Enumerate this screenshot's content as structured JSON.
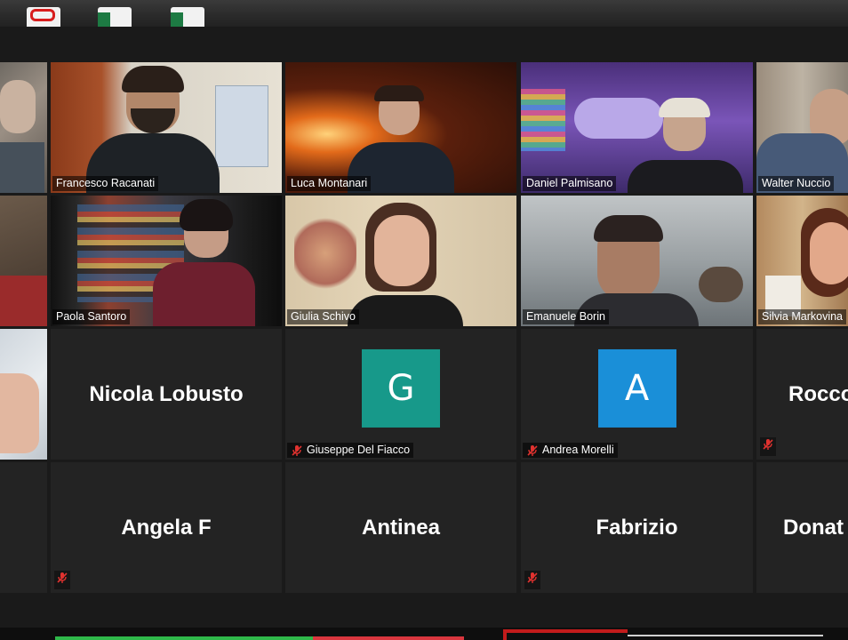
{
  "desktop": {
    "icons": [
      "pdf-file-icon",
      "excel-file-icon",
      "excel-file-icon"
    ]
  },
  "gallery": {
    "row1": [
      {
        "name": ""
      },
      {
        "name": "Francesco Racanati"
      },
      {
        "name": "Luca Montanari"
      },
      {
        "name": "Daniel Palmisano"
      },
      {
        "name": "Walter Nuccio"
      }
    ],
    "row2": [
      {
        "name": ""
      },
      {
        "name": "Paola Santoro"
      },
      {
        "name": "Giulia Schivo"
      },
      {
        "name": "Emanuele Borin"
      },
      {
        "name": "Silvia Markovina"
      }
    ],
    "row3": [
      {
        "name": ""
      },
      {
        "display_name": "Nicola Lobusto"
      },
      {
        "name": "Giuseppe Del Fiacco",
        "avatar_letter": "G",
        "avatar_color": "#17998a",
        "muted": true
      },
      {
        "name": "Andrea Morelli",
        "avatar_letter": "A",
        "avatar_color": "#1a8fd8",
        "muted": true
      },
      {
        "display_name": "Rocco",
        "muted": true
      }
    ],
    "row4": [
      {
        "name": ""
      },
      {
        "display_name": "Angela F",
        "muted": true
      },
      {
        "display_name": "Antinea"
      },
      {
        "display_name": "Fabrizio",
        "muted": true
      },
      {
        "display_name": "Donat"
      }
    ]
  },
  "colors": {
    "active_speaker_border": "#e9e77a",
    "mute_icon": "#e0322f",
    "background": "#1a1a1a"
  }
}
